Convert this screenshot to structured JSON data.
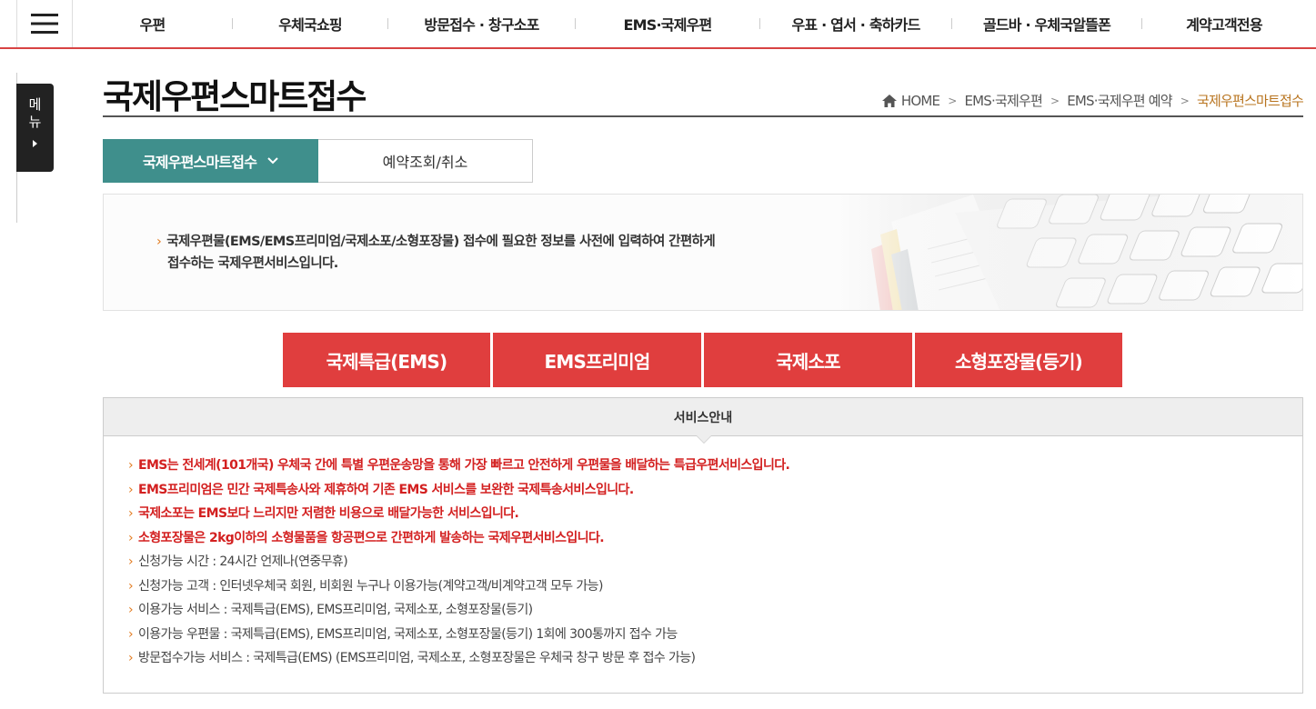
{
  "topnav": {
    "items": [
      "우편",
      "우체국쇼핑",
      "방문접수 · 창구소포",
      "EMS·국제우편",
      "우표 · 엽서 · 축하카드",
      "골드바 · 우체국알뜰폰",
      "계약고객전용"
    ]
  },
  "side_menu": {
    "label_1": "메",
    "label_2": "뉴"
  },
  "page": {
    "title": "국제우편스마트접수"
  },
  "breadcrumb": {
    "items": [
      "HOME",
      "EMS·국제우편",
      "EMS·국제우편 예약"
    ],
    "current": "국제우편스마트접수"
  },
  "subtabs": {
    "active": "국제우편스마트접수",
    "other": "예약조회/취소"
  },
  "intro": {
    "line1": "국제우편물(EMS/EMS프리미엄/국제소포/소형포장물) 접수에 필요한 정보를 사전에 입력하여 간편하게",
    "line2": "접수하는 국제우편서비스입니다."
  },
  "service_buttons": [
    "국제특급(EMS)",
    "EMS프리미엄",
    "국제소포",
    "소형포장물(등기)"
  ],
  "info": {
    "title": "서비스안내",
    "items": [
      "EMS는 전세계(101개국) 우체국 간에 특별 우편운송망을 통해 가장 빠르고 안전하게 우편물을 배달하는 특급우편서비스입니다.",
      "EMS프리미엄은 민간 국제특송사와 제휴하여 기존 EMS 서비스를 보완한 국제특송서비스입니다.",
      "국제소포는 EMS보다 느리지만 저렴한 비용으로 배달가능한 서비스입니다.",
      "소형포장물은 2kg이하의 소형물품을 항공편으로 간편하게 발송하는 국제우편서비스입니다.",
      "신청가능 시간 : 24시간 언제나(연중무휴)",
      "신청가능 고객 : 인터넷우체국 회원, 비회원 누구나 이용가능(계약고객/비계약고객 모두 가능)",
      "이용가능 서비스 : 국제특급(EMS), EMS프리미엄, 국제소포, 소형포장물(등기)",
      "이용가능 우편물 : 국제특급(EMS), EMS프리미엄, 국제소포, 소형포장물(등기) 1회에 300통까지 접수 가능",
      "방문접수가능 서비스 : 국제특급(EMS) (EMS프리미엄, 국제소포, 소형포장물은 우체국 창구 방문 후 접수 가능)"
    ]
  },
  "colors": {
    "nav_underline": "#d84343",
    "subtab_active": "#3f8f8c",
    "service_button": "#e03e3e",
    "highlight_text": "#d32020",
    "breadcrumb_current": "#b8741f",
    "bullet": "#e27a1e"
  },
  "icons": {
    "menu": "hamburger-icon",
    "home": "home-icon",
    "dropdown": "chevron-down-icon"
  }
}
